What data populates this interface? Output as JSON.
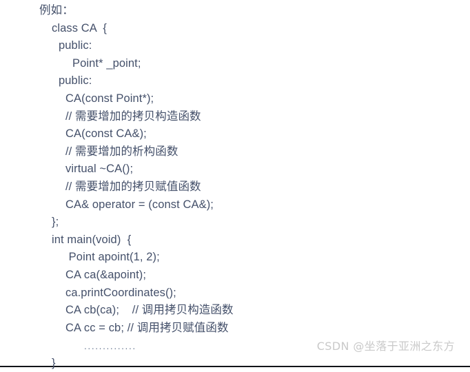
{
  "snippet": {
    "intro_label": "例如：",
    "lines": [
      {
        "indent": 0,
        "text": "例如："
      },
      {
        "indent": 1,
        "text": "class CA  {"
      },
      {
        "indent": 2,
        "text": "public:"
      },
      {
        "indent": 4,
        "text": "Point* _point;"
      },
      {
        "indent": 2,
        "text": "public:"
      },
      {
        "indent": 3,
        "text": "CA(const Point*);"
      },
      {
        "indent": 3,
        "text": "// 需要增加的拷贝构造函数"
      },
      {
        "indent": 3,
        "text": "CA(const CA&);"
      },
      {
        "indent": 3,
        "text": "// 需要增加的析构函数"
      },
      {
        "indent": 3,
        "text": "virtual ~CA();"
      },
      {
        "indent": 3,
        "text": "// 需要增加的拷贝赋值函数"
      },
      {
        "indent": 3,
        "text": "CA& operator = (const CA&);"
      },
      {
        "indent": 1,
        "text": "};"
      },
      {
        "indent": 1,
        "text": "int main(void)  {"
      },
      {
        "indent": 3,
        "text": " Point apoint(1, 2);"
      },
      {
        "indent": 3,
        "text": "CA ca(&apoint);"
      },
      {
        "indent": 3,
        "text": "ca.printCoordinates();"
      },
      {
        "indent": 3,
        "text": "CA cb(ca);    // 调用拷贝构造函数"
      },
      {
        "indent": 3,
        "text": "CA cc = cb; // 调用拷贝赋值函数"
      },
      {
        "indent": 6,
        "text": "..............",
        "is_dots": true
      },
      {
        "indent": 1,
        "text": "}"
      }
    ]
  },
  "watermark": {
    "text": "CSDN @坐落于亚洲之东方"
  },
  "colors": {
    "text": "#44506a",
    "background": "#ffffff",
    "watermark": "#c9c9c9",
    "bottom_rule": "#111318"
  }
}
